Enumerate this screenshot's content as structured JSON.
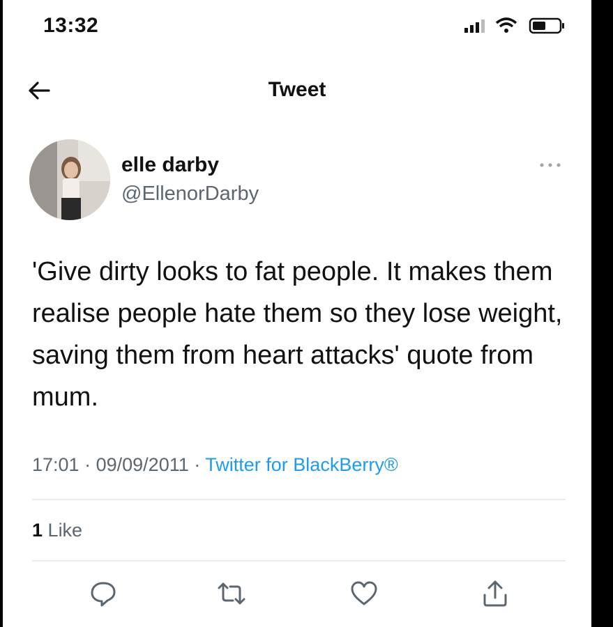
{
  "status_bar": {
    "time": "13:32",
    "icons": [
      "signal-icon",
      "wifi-icon",
      "battery-icon"
    ]
  },
  "header": {
    "title": "Tweet",
    "back_icon": "back-arrow-icon"
  },
  "tweet": {
    "author": {
      "name": "elle darby",
      "handle": "@EllenorDarby"
    },
    "text": "'Give dirty looks to fat people. It makes them realise people hate them so they lose weight, saving them from heart attacks' quote from mum.",
    "meta": {
      "time": "17:01",
      "separator": "·",
      "date": "09/09/2011",
      "source": "Twitter for BlackBerry®"
    },
    "stats": {
      "likes_count": "1",
      "likes_label": "Like"
    },
    "actions": [
      "reply-icon",
      "retweet-icon",
      "like-icon",
      "share-icon"
    ]
  },
  "colors": {
    "text": "#111111",
    "secondary": "#5b6670",
    "link": "#1d9bf0",
    "divider": "#e6ecf0"
  }
}
